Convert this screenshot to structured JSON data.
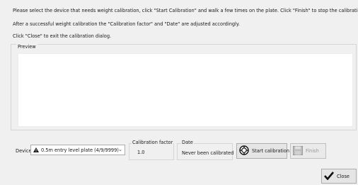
{
  "instructions": {
    "line1": "Please select the device that needs weight calibration, click \"Start Calibration\" and walk a few times on the plate. Click \"Finish\" to stop the calibration.",
    "line2": "After a successful weight calibration the \"Calibration factor\" and \"Date\" are adjusted accordingly.",
    "line3": "Click \"Close\" to exit the calibration dialog."
  },
  "preview": {
    "legend": "Preview"
  },
  "device": {
    "label": "Device",
    "selected": "0.5m entry level plate (4/9/9999)",
    "icon": "warning-icon"
  },
  "calibration_factor": {
    "legend": "Calibration factor",
    "value": "1.0"
  },
  "date": {
    "legend": "Date",
    "value": "Never been calibrated"
  },
  "buttons": {
    "start": "Start calibration",
    "finish": "Finish",
    "close": "Close"
  }
}
